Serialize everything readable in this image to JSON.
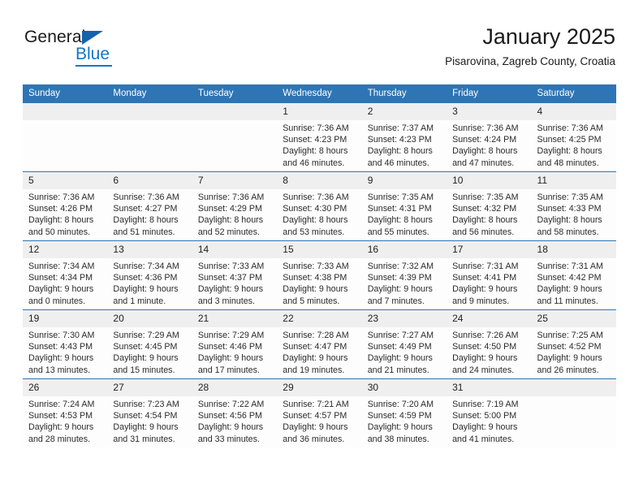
{
  "brand": {
    "word1": "General",
    "word2": "Blue",
    "triangle_color": "#1463ad",
    "blue_color": "#1577c4"
  },
  "header": {
    "title": "January 2025",
    "subtitle": "Pisarovina, Zagreb County, Croatia"
  },
  "theme": {
    "header_bg": "#2e75b6",
    "row_rule": "#2e75b6",
    "daynum_bg": "#efefef",
    "cell_bg": "#fdfdfd",
    "text": "#222222"
  },
  "calendar": {
    "weekday_headers": [
      "Sunday",
      "Monday",
      "Tuesday",
      "Wednesday",
      "Thursday",
      "Friday",
      "Saturday"
    ],
    "weeks": [
      [
        {
          "day": "",
          "lines": []
        },
        {
          "day": "",
          "lines": []
        },
        {
          "day": "",
          "lines": []
        },
        {
          "day": "1",
          "lines": [
            "Sunrise: 7:36 AM",
            "Sunset: 4:23 PM",
            "Daylight: 8 hours and 46 minutes."
          ]
        },
        {
          "day": "2",
          "lines": [
            "Sunrise: 7:37 AM",
            "Sunset: 4:23 PM",
            "Daylight: 8 hours and 46 minutes."
          ]
        },
        {
          "day": "3",
          "lines": [
            "Sunrise: 7:36 AM",
            "Sunset: 4:24 PM",
            "Daylight: 8 hours and 47 minutes."
          ]
        },
        {
          "day": "4",
          "lines": [
            "Sunrise: 7:36 AM",
            "Sunset: 4:25 PM",
            "Daylight: 8 hours and 48 minutes."
          ]
        }
      ],
      [
        {
          "day": "5",
          "lines": [
            "Sunrise: 7:36 AM",
            "Sunset: 4:26 PM",
            "Daylight: 8 hours and 50 minutes."
          ]
        },
        {
          "day": "6",
          "lines": [
            "Sunrise: 7:36 AM",
            "Sunset: 4:27 PM",
            "Daylight: 8 hours and 51 minutes."
          ]
        },
        {
          "day": "7",
          "lines": [
            "Sunrise: 7:36 AM",
            "Sunset: 4:29 PM",
            "Daylight: 8 hours and 52 minutes."
          ]
        },
        {
          "day": "8",
          "lines": [
            "Sunrise: 7:36 AM",
            "Sunset: 4:30 PM",
            "Daylight: 8 hours and 53 minutes."
          ]
        },
        {
          "day": "9",
          "lines": [
            "Sunrise: 7:35 AM",
            "Sunset: 4:31 PM",
            "Daylight: 8 hours and 55 minutes."
          ]
        },
        {
          "day": "10",
          "lines": [
            "Sunrise: 7:35 AM",
            "Sunset: 4:32 PM",
            "Daylight: 8 hours and 56 minutes."
          ]
        },
        {
          "day": "11",
          "lines": [
            "Sunrise: 7:35 AM",
            "Sunset: 4:33 PM",
            "Daylight: 8 hours and 58 minutes."
          ]
        }
      ],
      [
        {
          "day": "12",
          "lines": [
            "Sunrise: 7:34 AM",
            "Sunset: 4:34 PM",
            "Daylight: 9 hours and 0 minutes."
          ]
        },
        {
          "day": "13",
          "lines": [
            "Sunrise: 7:34 AM",
            "Sunset: 4:36 PM",
            "Daylight: 9 hours and 1 minute."
          ]
        },
        {
          "day": "14",
          "lines": [
            "Sunrise: 7:33 AM",
            "Sunset: 4:37 PM",
            "Daylight: 9 hours and 3 minutes."
          ]
        },
        {
          "day": "15",
          "lines": [
            "Sunrise: 7:33 AM",
            "Sunset: 4:38 PM",
            "Daylight: 9 hours and 5 minutes."
          ]
        },
        {
          "day": "16",
          "lines": [
            "Sunrise: 7:32 AM",
            "Sunset: 4:39 PM",
            "Daylight: 9 hours and 7 minutes."
          ]
        },
        {
          "day": "17",
          "lines": [
            "Sunrise: 7:31 AM",
            "Sunset: 4:41 PM",
            "Daylight: 9 hours and 9 minutes."
          ]
        },
        {
          "day": "18",
          "lines": [
            "Sunrise: 7:31 AM",
            "Sunset: 4:42 PM",
            "Daylight: 9 hours and 11 minutes."
          ]
        }
      ],
      [
        {
          "day": "19",
          "lines": [
            "Sunrise: 7:30 AM",
            "Sunset: 4:43 PM",
            "Daylight: 9 hours and 13 minutes."
          ]
        },
        {
          "day": "20",
          "lines": [
            "Sunrise: 7:29 AM",
            "Sunset: 4:45 PM",
            "Daylight: 9 hours and 15 minutes."
          ]
        },
        {
          "day": "21",
          "lines": [
            "Sunrise: 7:29 AM",
            "Sunset: 4:46 PM",
            "Daylight: 9 hours and 17 minutes."
          ]
        },
        {
          "day": "22",
          "lines": [
            "Sunrise: 7:28 AM",
            "Sunset: 4:47 PM",
            "Daylight: 9 hours and 19 minutes."
          ]
        },
        {
          "day": "23",
          "lines": [
            "Sunrise: 7:27 AM",
            "Sunset: 4:49 PM",
            "Daylight: 9 hours and 21 minutes."
          ]
        },
        {
          "day": "24",
          "lines": [
            "Sunrise: 7:26 AM",
            "Sunset: 4:50 PM",
            "Daylight: 9 hours and 24 minutes."
          ]
        },
        {
          "day": "25",
          "lines": [
            "Sunrise: 7:25 AM",
            "Sunset: 4:52 PM",
            "Daylight: 9 hours and 26 minutes."
          ]
        }
      ],
      [
        {
          "day": "26",
          "lines": [
            "Sunrise: 7:24 AM",
            "Sunset: 4:53 PM",
            "Daylight: 9 hours and 28 minutes."
          ]
        },
        {
          "day": "27",
          "lines": [
            "Sunrise: 7:23 AM",
            "Sunset: 4:54 PM",
            "Daylight: 9 hours and 31 minutes."
          ]
        },
        {
          "day": "28",
          "lines": [
            "Sunrise: 7:22 AM",
            "Sunset: 4:56 PM",
            "Daylight: 9 hours and 33 minutes."
          ]
        },
        {
          "day": "29",
          "lines": [
            "Sunrise: 7:21 AM",
            "Sunset: 4:57 PM",
            "Daylight: 9 hours and 36 minutes."
          ]
        },
        {
          "day": "30",
          "lines": [
            "Sunrise: 7:20 AM",
            "Sunset: 4:59 PM",
            "Daylight: 9 hours and 38 minutes."
          ]
        },
        {
          "day": "31",
          "lines": [
            "Sunrise: 7:19 AM",
            "Sunset: 5:00 PM",
            "Daylight: 9 hours and 41 minutes."
          ]
        },
        {
          "day": "",
          "lines": []
        }
      ]
    ]
  }
}
